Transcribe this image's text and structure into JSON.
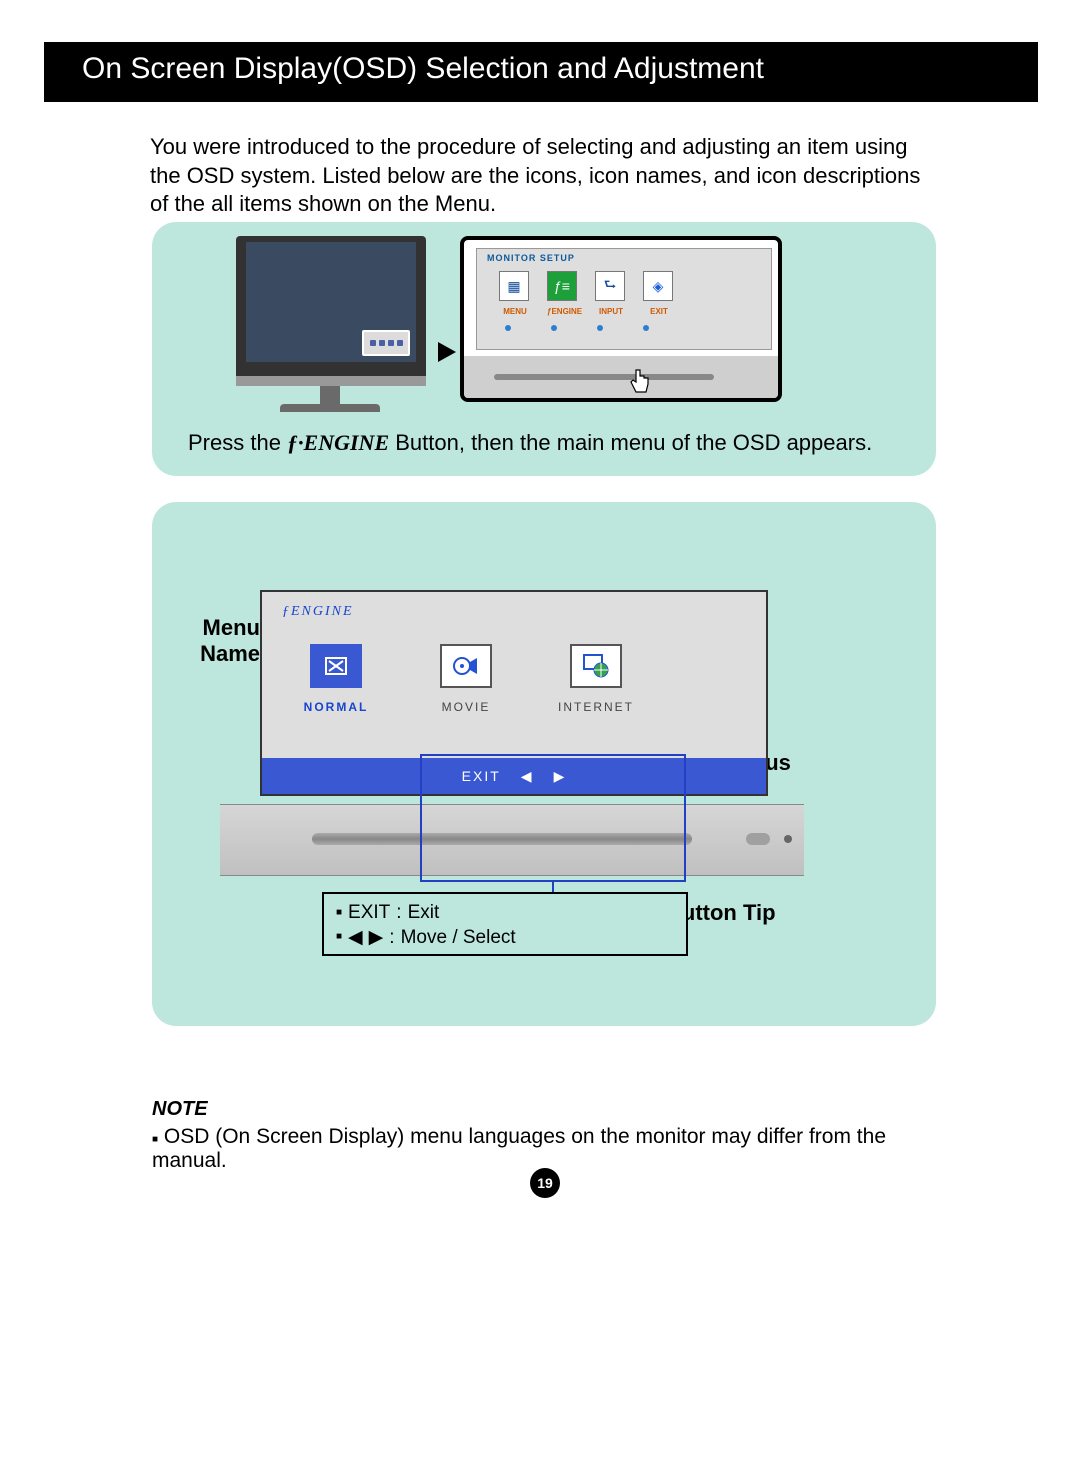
{
  "header": {
    "title": "On Screen Display(OSD) Selection and Adjustment"
  },
  "intro_text": "You were introduced to the procedure of selecting and adjusting an item using the OSD system. Listed below are the icons, icon names, and icon descriptions of the all items shown on the Menu.",
  "panel1": {
    "zoom_title": "MONITOR SETUP",
    "labels": {
      "menu": "MENU",
      "engine": "ƒENGINE",
      "input": "INPUT",
      "exit": "EXIT"
    },
    "caption_prefix": "Press the ",
    "caption_engine": "ƒ·ENGINE",
    "caption_suffix": " Button, then the main menu of the OSD appears."
  },
  "panel2": {
    "label_menu_name": "Menu Name",
    "label_sub_menus": "Sub-\nmenus",
    "label_button_tip": "Button Tip",
    "osd_title": "ƒENGINE",
    "items": [
      {
        "label": "NORMAL",
        "selected": true
      },
      {
        "label": "MOVIE",
        "selected": false
      },
      {
        "label": "INTERNET",
        "selected": false
      }
    ],
    "footer_exit": "EXIT",
    "tips": {
      "exit_key": "EXIT",
      "exit_desc": "Exit",
      "move_desc": "Move / Select"
    }
  },
  "note": {
    "heading": "NOTE",
    "body": "OSD (On Screen Display) menu languages on the monitor may differ from the manual."
  },
  "page_number": "19"
}
